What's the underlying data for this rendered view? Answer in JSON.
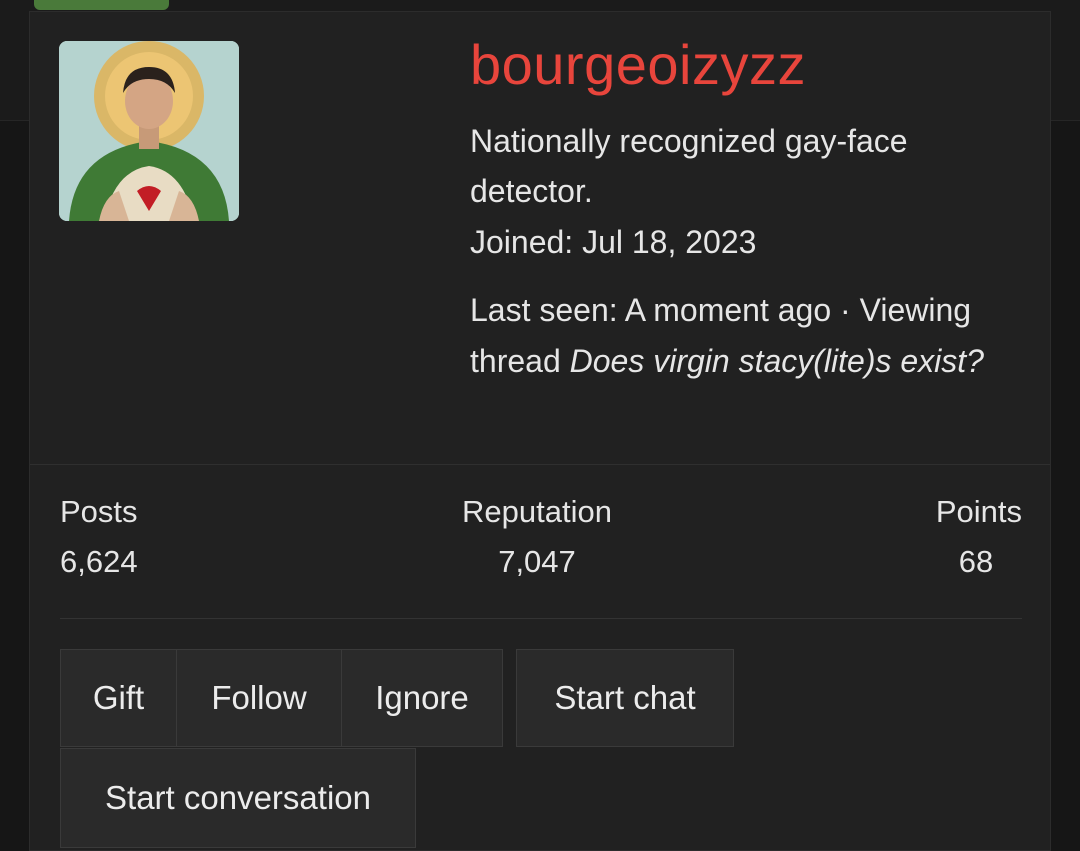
{
  "profile": {
    "username": "bourgeoizyzz",
    "title": "Nationally recognized gay-face detector.",
    "joined": "Joined: Jul 18, 2023",
    "last_seen_prefix": "Last seen: A moment ago · Viewing thread ",
    "last_seen_thread": "Does virgin stacy(lite)s exist?"
  },
  "stats": {
    "posts_label": "Posts",
    "posts_value": "6,624",
    "reputation_label": "Reputation",
    "reputation_value": "7,047",
    "points_label": "Points",
    "points_value": "68"
  },
  "actions": {
    "gift": "Gift",
    "follow": "Follow",
    "ignore": "Ignore",
    "start_chat": "Start chat",
    "start_conversation": "Start conversation"
  },
  "colors": {
    "username": "#e8453c",
    "card_bg": "#212121",
    "text": "#e6e6e6",
    "button_bg": "#2a2a2a"
  }
}
